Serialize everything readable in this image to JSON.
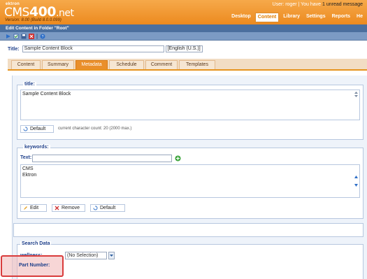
{
  "header": {
    "logo_small": "ektron",
    "logo_cms": "CMS",
    "logo_num": "400",
    "logo_net": ".net",
    "version": "Version: 8.00 (Build 8.0.0.099)",
    "user_text": "User: roger | You have ",
    "unread_text": "1 unread message",
    "nav": [
      {
        "label": "Desktop",
        "active": false
      },
      {
        "label": "Content",
        "active": true
      },
      {
        "label": "Library",
        "active": false
      },
      {
        "label": "Settings",
        "active": false
      },
      {
        "label": "Reports",
        "active": false
      },
      {
        "label": "He",
        "active": false
      }
    ]
  },
  "titlebar": {
    "text": "Edit Content in Folder \"Root\""
  },
  "title_row": {
    "label": "Title:",
    "value": "Sample Content Block",
    "language": "[English (U.S.)]"
  },
  "tabs": [
    {
      "label": "Content",
      "active": false
    },
    {
      "label": "Summary",
      "active": false
    },
    {
      "label": "Metadata",
      "active": true
    },
    {
      "label": "Schedule",
      "active": false
    },
    {
      "label": "Comment",
      "active": false
    },
    {
      "label": "Templates",
      "active": false
    }
  ],
  "title_section": {
    "legend": "title:",
    "value": "Sample Content Block",
    "default_button": "Default",
    "char_count": "current character count: 20   (2000 max.)"
  },
  "keywords_section": {
    "legend": "keywords:",
    "text_label": "Text:",
    "items": [
      "CMS",
      "Ektron"
    ],
    "edit_button": "Edit",
    "remove_button": "Remove",
    "default_button": "Default"
  },
  "search_section": {
    "legend": "Search Data",
    "wellness_label": "wellness:",
    "selection_value": "(No Selection)",
    "part_number_label": "Part Number:"
  },
  "colors": {
    "header_orange": "#ec8a1f",
    "titlebar_blue": "#4b6f9e",
    "highlight_red": "#d93b3b"
  }
}
